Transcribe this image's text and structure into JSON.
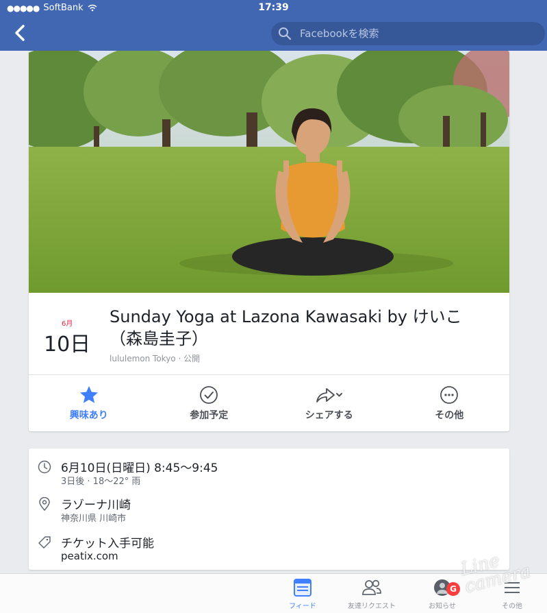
{
  "status_bar": {
    "carrier": "SoftBank",
    "time": "17:39"
  },
  "search": {
    "placeholder": "Facebookを検索"
  },
  "event": {
    "month": "6月",
    "day": "10日",
    "title": "Sunday Yoga at Lazona Kawasaki by けいこ（森島圭子）",
    "host": "lululemon Tokyo · 公開"
  },
  "actions": [
    {
      "label": "興味あり",
      "icon": "star-icon",
      "active": true
    },
    {
      "label": "参加予定",
      "icon": "check-circle-icon",
      "active": false
    },
    {
      "label": "シェアする",
      "icon": "share-icon",
      "active": false
    },
    {
      "label": "その他",
      "icon": "more-icon",
      "active": false
    }
  ],
  "details": {
    "time": {
      "main": "6月10日(日曜日) 8:45〜9:45",
      "sub": "3日後 · 18〜22° 雨"
    },
    "place": {
      "main": "ラゾーナ川崎",
      "sub": "神奈川県 川崎市"
    },
    "ticket": {
      "main": "チケット入手可能",
      "sub": "peatix.com"
    }
  },
  "tabbar": [
    {
      "label": "フィード",
      "icon": "feed-icon",
      "active": true
    },
    {
      "label": "友達リクエスト",
      "icon": "friends-icon",
      "active": false
    },
    {
      "label": "お知らせ",
      "icon": "notifications-icon",
      "active": false,
      "badge": "G"
    },
    {
      "label": "その他",
      "icon": "menu-icon",
      "active": false
    }
  ],
  "watermark": {
    "line1": "Line",
    "line2": "camera"
  },
  "colors": {
    "brand": "#4267b2",
    "accent": "#4080ff",
    "date_red": "#e41e3f"
  }
}
